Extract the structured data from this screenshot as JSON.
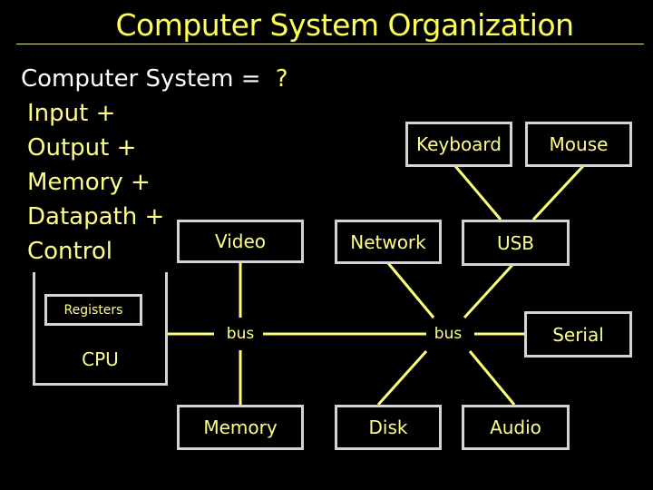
{
  "title": "Computer System Organization",
  "heading": {
    "text": "Computer System = ",
    "question": "?"
  },
  "components_list": [
    "Input +",
    "Output +",
    "Memory +",
    "Datapath +",
    "Control"
  ],
  "diagram": {
    "boxes": {
      "keyboard": "Keyboard",
      "mouse": "Mouse",
      "video": "Video",
      "network": "Network",
      "usb": "USB",
      "registers": "Registers",
      "cpu": "CPU",
      "serial": "Serial",
      "memory": "Memory",
      "disk": "Disk",
      "audio": "Audio"
    },
    "bus_labels": [
      "bus",
      "bus"
    ],
    "connections": [
      [
        "keyboard",
        "usb"
      ],
      [
        "mouse",
        "usb"
      ],
      [
        "video",
        "bus-1"
      ],
      [
        "cpu",
        "bus-1"
      ],
      [
        "bus-1",
        "memory"
      ],
      [
        "bus-1",
        "bus-2"
      ],
      [
        "network",
        "bus-2"
      ],
      [
        "usb",
        "bus-2"
      ],
      [
        "bus-2",
        "serial"
      ],
      [
        "bus-2",
        "disk"
      ],
      [
        "bus-2",
        "audio"
      ]
    ]
  },
  "colors": {
    "background": "#000000",
    "title": "#ffff55",
    "text": "#ffff88",
    "heading": "#ffffff",
    "box_border": "#d4d4d4",
    "line": "#ffff77"
  }
}
